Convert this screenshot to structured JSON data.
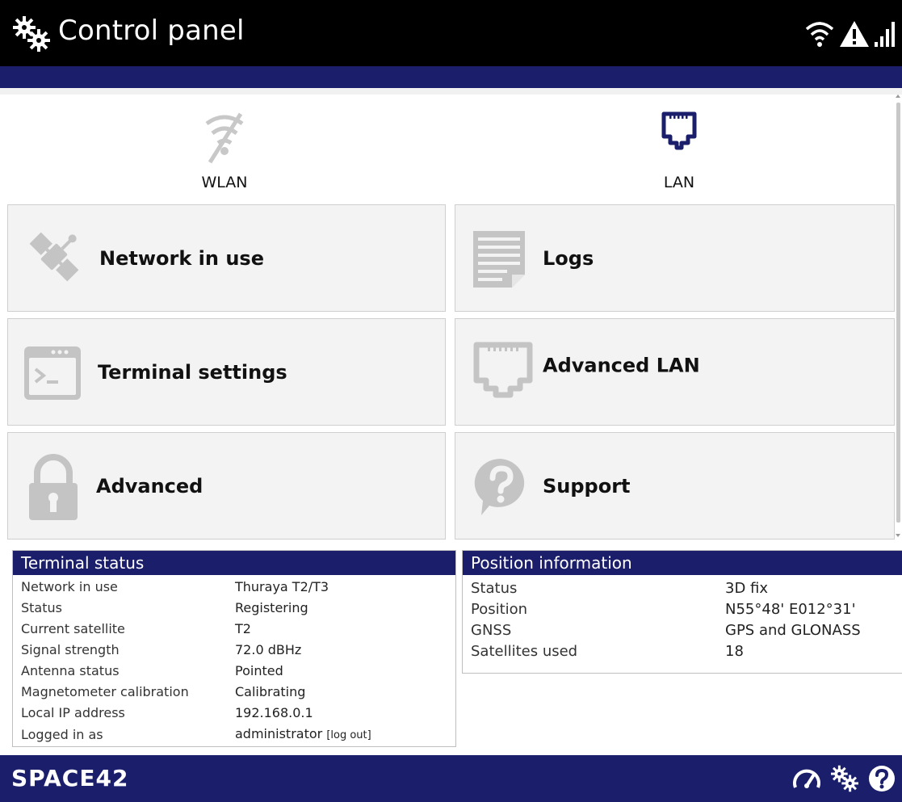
{
  "header": {
    "title": "Control panel",
    "icons": [
      "settings-gears-icon",
      "wifi-icon",
      "warning-icon",
      "signal-bars-icon"
    ]
  },
  "quick_links": [
    {
      "label": "WLAN",
      "icon": "wifi-off-icon"
    },
    {
      "label": "LAN",
      "icon": "ethernet-port-icon"
    }
  ],
  "tiles": [
    {
      "label": "Network in use",
      "icon": "satellite-icon"
    },
    {
      "label": "Logs",
      "icon": "document-icon"
    },
    {
      "label": "Terminal settings",
      "icon": "terminal-icon"
    },
    {
      "label": "Advanced LAN",
      "icon": "ethernet-port-icon"
    },
    {
      "label": "Advanced",
      "icon": "lock-icon"
    },
    {
      "label": "Support",
      "icon": "help-bubble-icon"
    }
  ],
  "terminal_status": {
    "title": "Terminal status",
    "rows": [
      {
        "key": "Network in use",
        "value": "Thuraya T2/T3"
      },
      {
        "key": "Status",
        "value": "Registering"
      },
      {
        "key": "Current satellite",
        "value": "T2"
      },
      {
        "key": "Signal strength",
        "value": "72.0 dBHz"
      },
      {
        "key": "Antenna status",
        "value": "Pointed"
      },
      {
        "key": "Magnetometer calibration",
        "value": "Calibrating"
      },
      {
        "key": "Local IP address",
        "value": "192.168.0.1"
      },
      {
        "key": "Logged in as",
        "value": "administrator",
        "action": "[log out]"
      }
    ]
  },
  "position_information": {
    "title": "Position information",
    "rows": [
      {
        "key": "Status",
        "value": "3D fix"
      },
      {
        "key": "Position",
        "value": "N55°48' E012°31'"
      },
      {
        "key": "GNSS",
        "value": "GPS and GLONASS"
      },
      {
        "key": "Satellites used",
        "value": "18"
      }
    ]
  },
  "footer": {
    "brand": "SPACE42",
    "icons": [
      "speedometer-icon",
      "settings-gears-icon",
      "help-icon"
    ]
  },
  "colors": {
    "navy": "#1b1f6b",
    "tile_bg": "#f3f3f3",
    "icon_gray": "#c4c4c4"
  }
}
